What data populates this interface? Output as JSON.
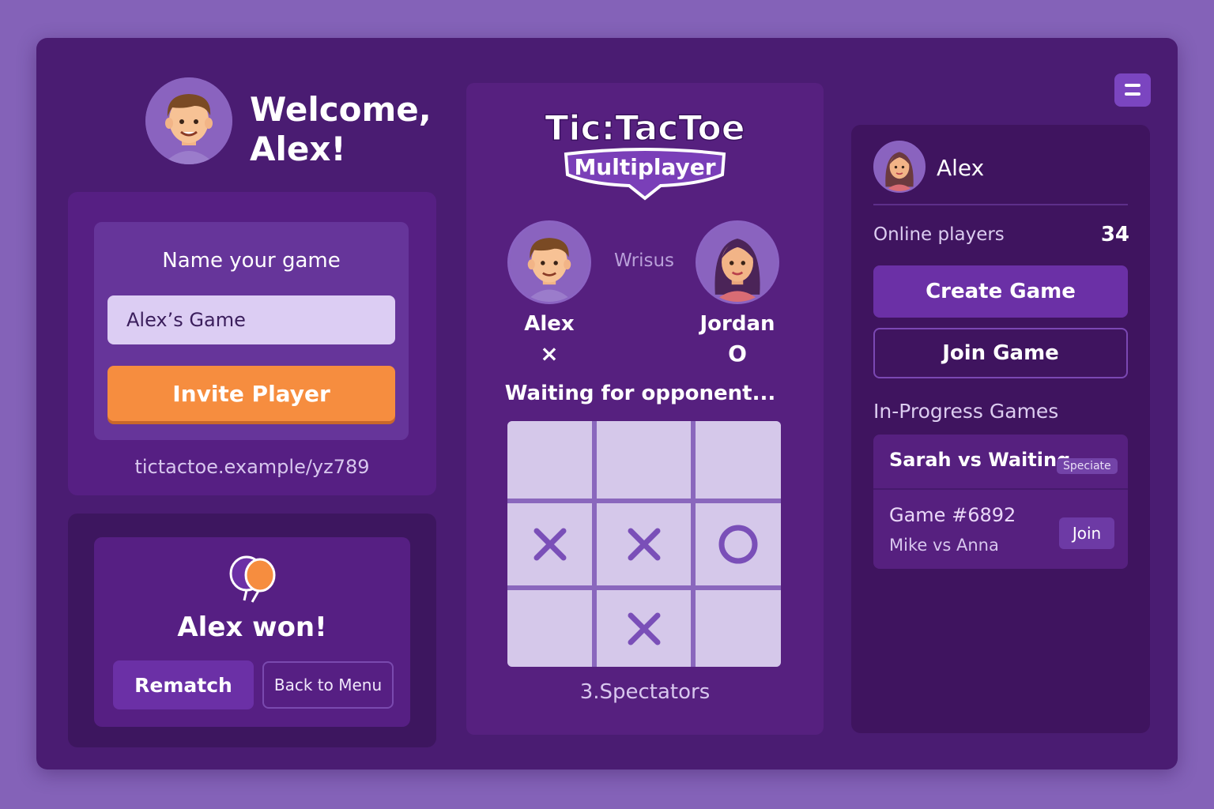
{
  "welcome": {
    "line1": "Welcome,",
    "line2": "Alex!"
  },
  "create_card": {
    "label": "Name your game",
    "input_value": "Alex’s Game",
    "invite_label": "Invite Player",
    "share_link": "tictactoe.example/yz789"
  },
  "result_card": {
    "message": "Alex won!",
    "rematch_label": "Rematch",
    "back_label": "Back to Menu"
  },
  "game": {
    "logo_title": "Tic:TacToe",
    "logo_subtitle": "Multiplayer",
    "vs_label": "Wrisus",
    "player1": {
      "name": "Alex",
      "mark": "×"
    },
    "player2": {
      "name": "Jordan",
      "mark": "O"
    },
    "status": "Waiting for opponent...",
    "board": [
      "",
      "",
      "",
      "X",
      "X",
      "O",
      "",
      "X",
      ""
    ],
    "spectators": "3.Spectators"
  },
  "sidebar": {
    "user_name": "Alex",
    "online_label": "Online players",
    "online_count": "34",
    "create_label": "Create Game",
    "join_label": "Join Game",
    "inprogress_title": "In-Progress Games",
    "games": [
      {
        "title": "Sarah vs Waiting",
        "badge": "Speciate"
      },
      {
        "title": "Game #6892",
        "subtitle": "Mike vs Anna",
        "action": "Join"
      }
    ]
  },
  "colors": {
    "background": "#8462b8",
    "frame": "#4a1c72",
    "accent_orange": "#f68d3f",
    "accent_purple": "#6b30a6",
    "board_cell": "#d5c8ea",
    "mark": "#7a4fb8"
  },
  "icons": {
    "menu": "hamburger-icon",
    "result": "balloons-icon"
  }
}
